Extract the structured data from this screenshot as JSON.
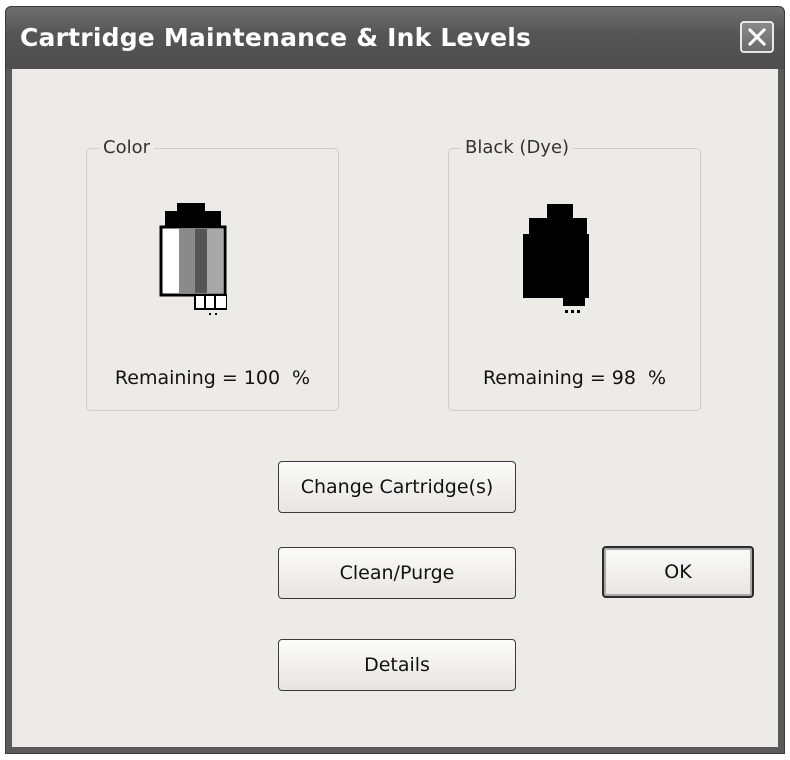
{
  "window": {
    "title": "Cartridge Maintenance & Ink Levels"
  },
  "cartridges": [
    {
      "label": "Color",
      "remaining_label": "Remaining =",
      "remaining_value": "100",
      "unit": "%"
    },
    {
      "label": "Black (Dye)",
      "remaining_label": "Remaining =",
      "remaining_value": "98",
      "unit": "%"
    }
  ],
  "buttons": {
    "change_cartridges": "Change Cartridge(s)",
    "clean_purge": "Clean/Purge",
    "details": "Details",
    "ok": "OK"
  },
  "icons": {
    "close": "close-icon",
    "color_cartridge": "color-cartridge-icon",
    "black_cartridge": "black-cartridge-icon"
  }
}
